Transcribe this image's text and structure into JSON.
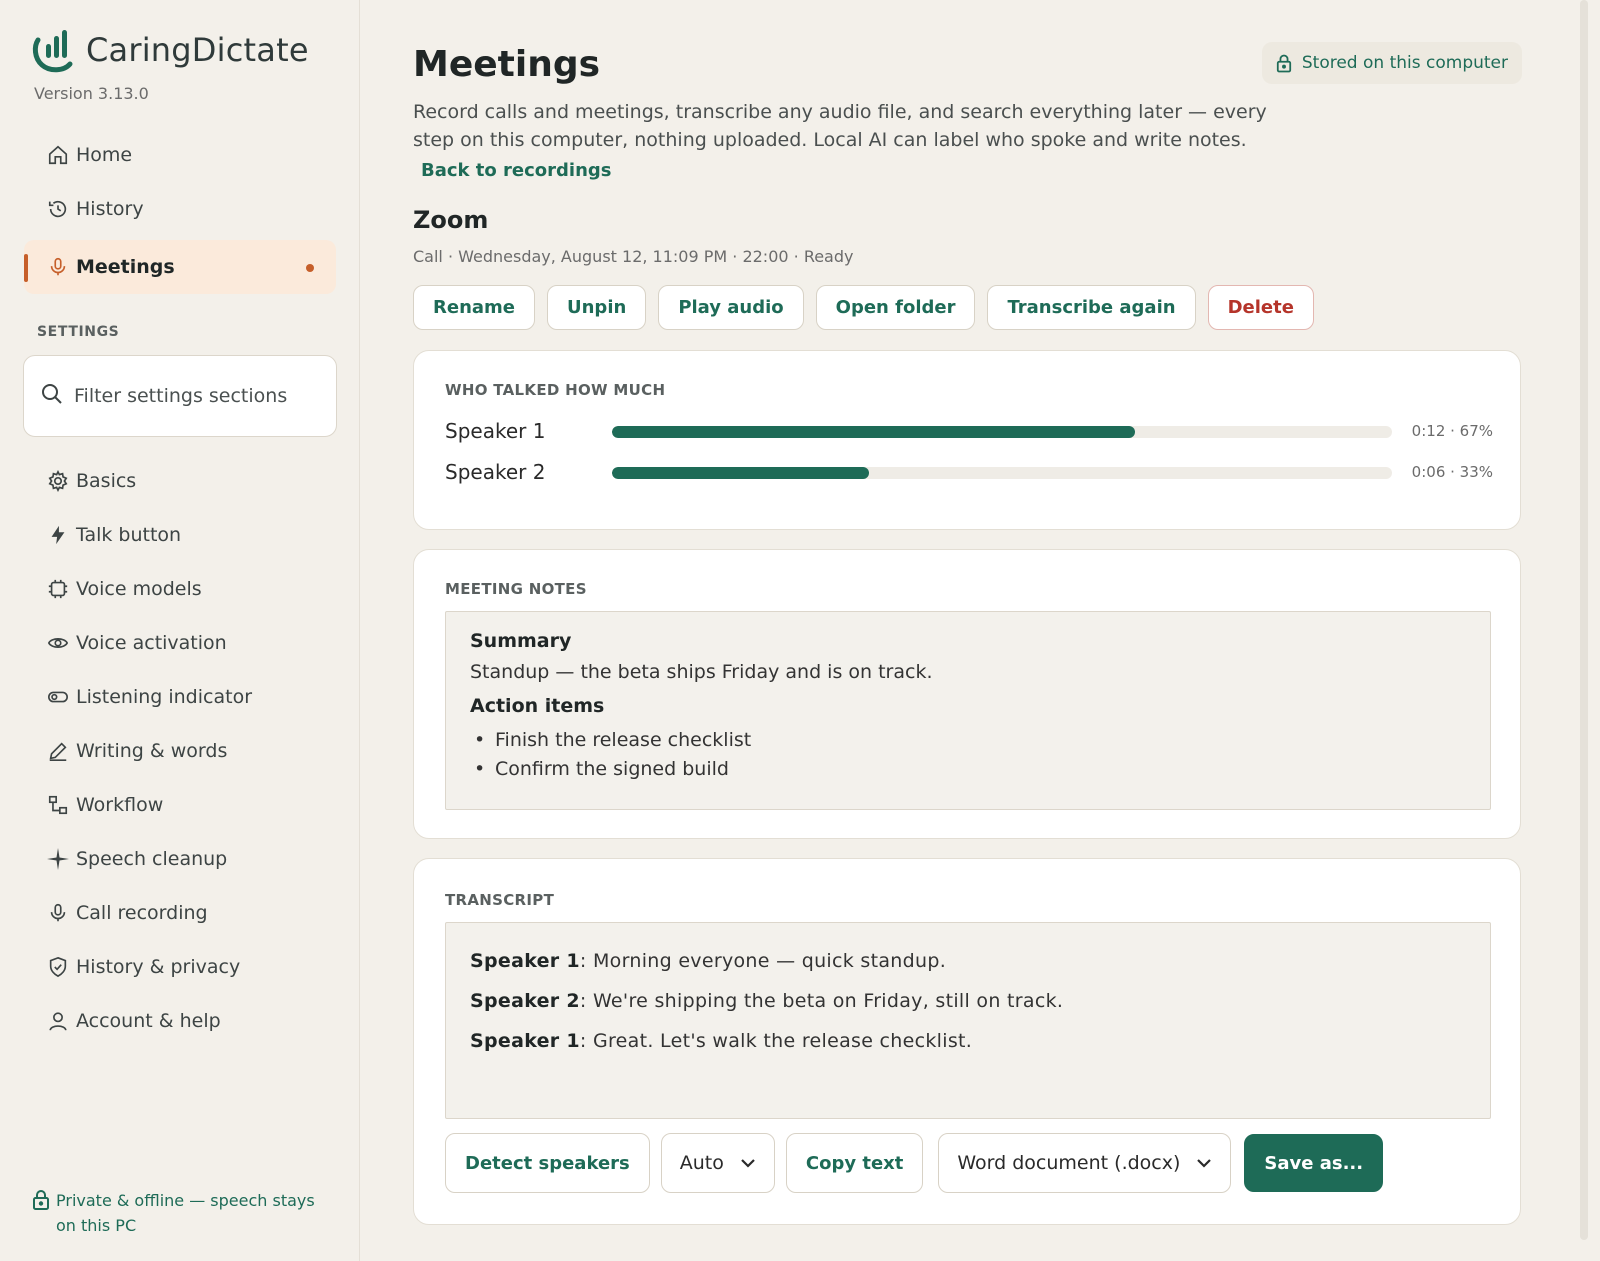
{
  "app": {
    "name": "CaringDictate",
    "version": "Version 3.13.0"
  },
  "nav": {
    "items": [
      {
        "label": "Home",
        "icon": "home-icon"
      },
      {
        "label": "History",
        "icon": "history-icon"
      },
      {
        "label": "Meetings",
        "icon": "mic-icon",
        "active": true
      }
    ]
  },
  "settings": {
    "section_label": "SETTINGS",
    "filter_placeholder": "Filter settings sections",
    "items": [
      {
        "label": "Basics",
        "icon": "gear-icon"
      },
      {
        "label": "Talk button",
        "icon": "bolt-icon"
      },
      {
        "label": "Voice models",
        "icon": "chip-icon"
      },
      {
        "label": "Voice activation",
        "icon": "eye-icon"
      },
      {
        "label": "Listening indicator",
        "icon": "toggle-icon"
      },
      {
        "label": "Writing & words",
        "icon": "pencil-icon"
      },
      {
        "label": "Workflow",
        "icon": "workflow-icon"
      },
      {
        "label": "Speech cleanup",
        "icon": "sparkle-icon"
      },
      {
        "label": "Call recording",
        "icon": "mic-icon"
      },
      {
        "label": "History & privacy",
        "icon": "shield-icon"
      },
      {
        "label": "Account & help",
        "icon": "user-icon"
      }
    ]
  },
  "footer": {
    "privacy_note": "Private & offline — speech stays on this PC"
  },
  "header": {
    "title": "Meetings",
    "stored_badge": "Stored on this computer",
    "description": "Record calls and meetings, transcribe any audio file, and search everything later — every step on this computer, nothing uploaded. Local AI can label who spoke and write notes.",
    "back_link": "Back to recordings"
  },
  "recording": {
    "title": "Zoom",
    "meta": "Call · Wednesday, August 12, 11:09 PM · 22:00 · Ready",
    "actions": {
      "rename": "Rename",
      "unpin": "Unpin",
      "play_audio": "Play audio",
      "open_folder": "Open folder",
      "transcribe_again": "Transcribe again",
      "delete": "Delete"
    }
  },
  "talk_time": {
    "label": "WHO TALKED HOW MUCH",
    "speakers": [
      {
        "name": "Speaker 1",
        "stat": "0:12 · 67%",
        "share": 0.67
      },
      {
        "name": "Speaker 2",
        "stat": "0:06 · 33%",
        "share": 0.33
      }
    ]
  },
  "notes": {
    "label": "MEETING NOTES",
    "summary_heading": "Summary",
    "summary_text": "Standup — the beta ships Friday and is on track.",
    "action_heading": "Action items",
    "action_items": [
      "Finish the release checklist",
      "Confirm the signed build"
    ]
  },
  "transcript": {
    "label": "TRANSCRIPT",
    "lines": [
      {
        "speaker": "Speaker 1",
        "text": ": Morning everyone — quick standup."
      },
      {
        "speaker": "Speaker 2",
        "text": ": We're shipping the beta on Friday, still on track."
      },
      {
        "speaker": "Speaker 1",
        "text": ": Great. Let's walk the release checklist."
      }
    ],
    "detect_speakers": "Detect speakers",
    "speaker_mode": "Auto",
    "copy_text": "Copy text",
    "export_format": "Word document (.docx)",
    "save_as": "Save as..."
  },
  "colors": {
    "accent": "#1e6b57",
    "active_marker": "#c65f2a",
    "danger": "#b5342a",
    "background": "#f3f0ea"
  }
}
